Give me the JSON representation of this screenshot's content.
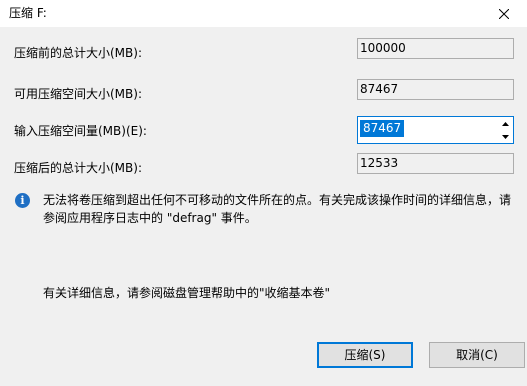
{
  "window": {
    "title": "压缩 F:",
    "close_icon": "close-icon"
  },
  "fields": {
    "total_before_label": "压缩前的总计大小(MB):",
    "total_before_value": "100000",
    "available_label": "可用压缩空间大小(MB):",
    "available_value": "87467",
    "input_label": "输入压缩空间量(MB)(E):",
    "input_value": "87467",
    "total_after_label": "压缩后的总计大小(MB):",
    "total_after_value": "12533"
  },
  "info": {
    "icon": "info-icon",
    "text": "无法将卷压缩到超出任何不可移动的文件所在的点。有关完成该操作时间的详细信息，请参阅应用程序日志中的 \"defrag\" 事件。"
  },
  "help": {
    "text": "有关详细信息，请参阅磁盘管理帮助中的\"收缩基本卷\""
  },
  "buttons": {
    "shrink": "压缩(S)",
    "cancel": "取消(C)"
  },
  "colors": {
    "accent": "#0078d7",
    "background": "#f0f0f0"
  }
}
